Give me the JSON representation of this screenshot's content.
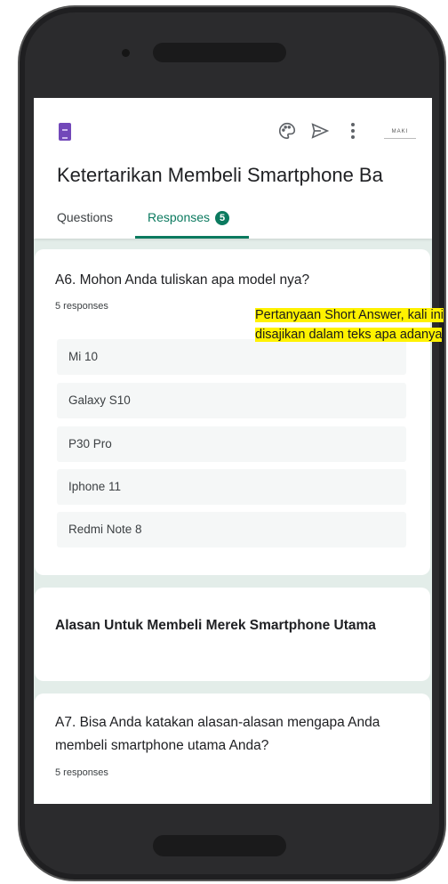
{
  "form": {
    "title": "Ketertarikan Membeli Smartphone Ba",
    "tabs": {
      "questions": "Questions",
      "responses": "Responses",
      "responses_count": "5"
    },
    "avatar_text": "MAKI"
  },
  "question_a6": {
    "title": "A6. Mohon Anda tuliskan apa model nya?",
    "count": "5 responses",
    "answers": [
      "Mi 10",
      "Galaxy S10",
      "P30 Pro",
      "Iphone 11",
      "Redmi Note 8"
    ]
  },
  "section": {
    "title": "Alasan Untuk Membeli Merek Smartphone Utama"
  },
  "question_a7": {
    "title": "A7. Bisa Anda katakan alasan-alasan mengapa Anda membeli smartphone utama Anda?",
    "count": "5 responses"
  },
  "annotation": {
    "line1": "Pertanyaan Short Answer, kali ini",
    "line2": "disajikan dalam teks apa adanya",
    "highlight_color": "#fff200"
  },
  "colors": {
    "accent": "#0b7a5f",
    "forms_purple": "#7248b9",
    "background": "#e3ede9"
  },
  "icons": [
    "forms-logo-icon",
    "palette-icon",
    "send-icon",
    "more-vert-icon"
  ]
}
